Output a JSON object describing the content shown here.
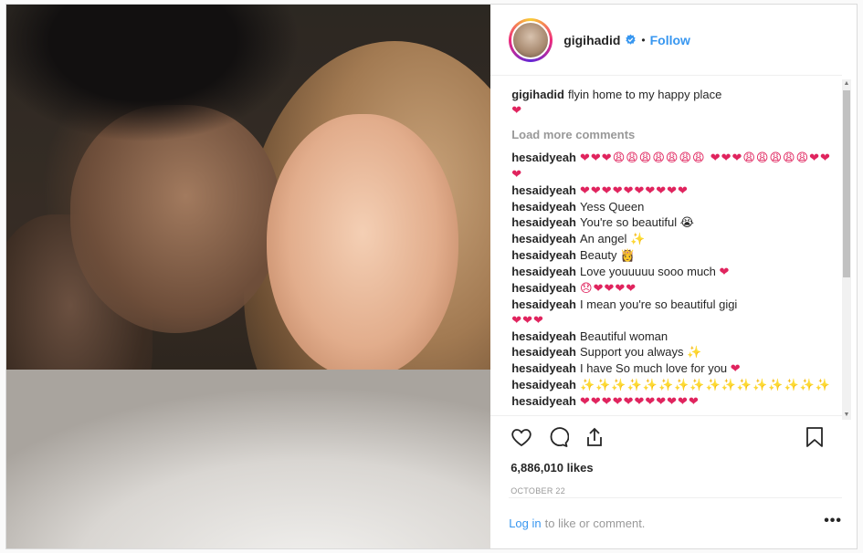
{
  "post": {
    "username": "gigihadid",
    "follow_label": "Follow",
    "separator": "•",
    "caption_user": "gigihadid",
    "caption_text": "flyin home to my happy place",
    "caption_emoji": "❤",
    "load_more": "Load more comments",
    "comments": [
      {
        "user": "hesaidyeah",
        "text": "",
        "emoji": "❤❤❤😩😩😩😩😩😩😩 ❤❤❤😩😩😩😩😩❤❤❤"
      },
      {
        "user": "hesaidyeah",
        "text": "",
        "emoji": "❤❤❤❤❤❤❤❤❤❤"
      },
      {
        "user": "hesaidyeah",
        "text": "Yess Queen",
        "emoji": ""
      },
      {
        "user": "hesaidyeah",
        "text": "You're so beautiful",
        "emoji": "😭"
      },
      {
        "user": "hesaidyeah",
        "text": "An angel",
        "emoji": "✨"
      },
      {
        "user": "hesaidyeah",
        "text": "Beauty",
        "emoji": "👸"
      },
      {
        "user": "hesaidyeah",
        "text": "Love youuuuu sooo much",
        "emoji": "❤"
      },
      {
        "user": "hesaidyeah",
        "text": "",
        "emoji": "😞❤❤❤❤"
      },
      {
        "user": "hesaidyeah",
        "text": "I mean you're so beautiful gigi",
        "emoji": "❤❤❤"
      },
      {
        "user": "hesaidyeah",
        "text": "Beautiful woman",
        "emoji": ""
      },
      {
        "user": "hesaidyeah",
        "text": "Support you always",
        "emoji": "✨"
      },
      {
        "user": "hesaidyeah",
        "text": "I have So much love for you",
        "emoji": "❤"
      },
      {
        "user": "hesaidyeah",
        "text": "",
        "emoji": "✨✨✨✨✨✨✨✨✨✨✨✨✨✨✨✨"
      },
      {
        "user": "hesaidyeah",
        "text": "",
        "emoji": "❤❤❤❤❤❤❤❤❤❤❤"
      }
    ],
    "likes": "6,886,010 likes",
    "date": "OCTOBER 22",
    "login_link": "Log in",
    "login_rest": "to like or comment.",
    "more_label": "•••"
  },
  "icons": [
    "verified-badge-icon",
    "heart-icon",
    "comment-icon",
    "share-icon",
    "bookmark-icon",
    "more-options-icon"
  ],
  "colors": {
    "accent": "#3897f0",
    "heart": "#e0245e",
    "text": "#262626",
    "muted": "#999999"
  }
}
